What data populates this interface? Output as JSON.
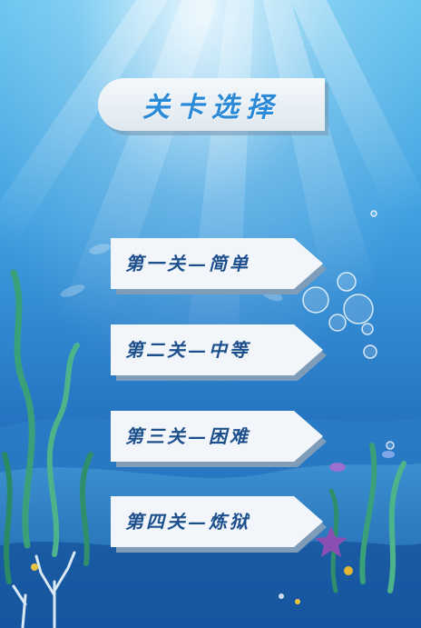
{
  "title": "关卡选择",
  "levels": [
    {
      "label": "第一关—简单"
    },
    {
      "label": "第二关—中等"
    },
    {
      "label": "第三关—困难"
    },
    {
      "label": "第四关—炼狱"
    }
  ],
  "colors": {
    "title_text": "#2b8ad8",
    "button_text": "#1c4f8c",
    "button_face": "#f2f6fa",
    "button_shadow": "#7f9cb8",
    "sea_top": "#5cbcec",
    "sea_bottom": "#0f4f9a"
  }
}
